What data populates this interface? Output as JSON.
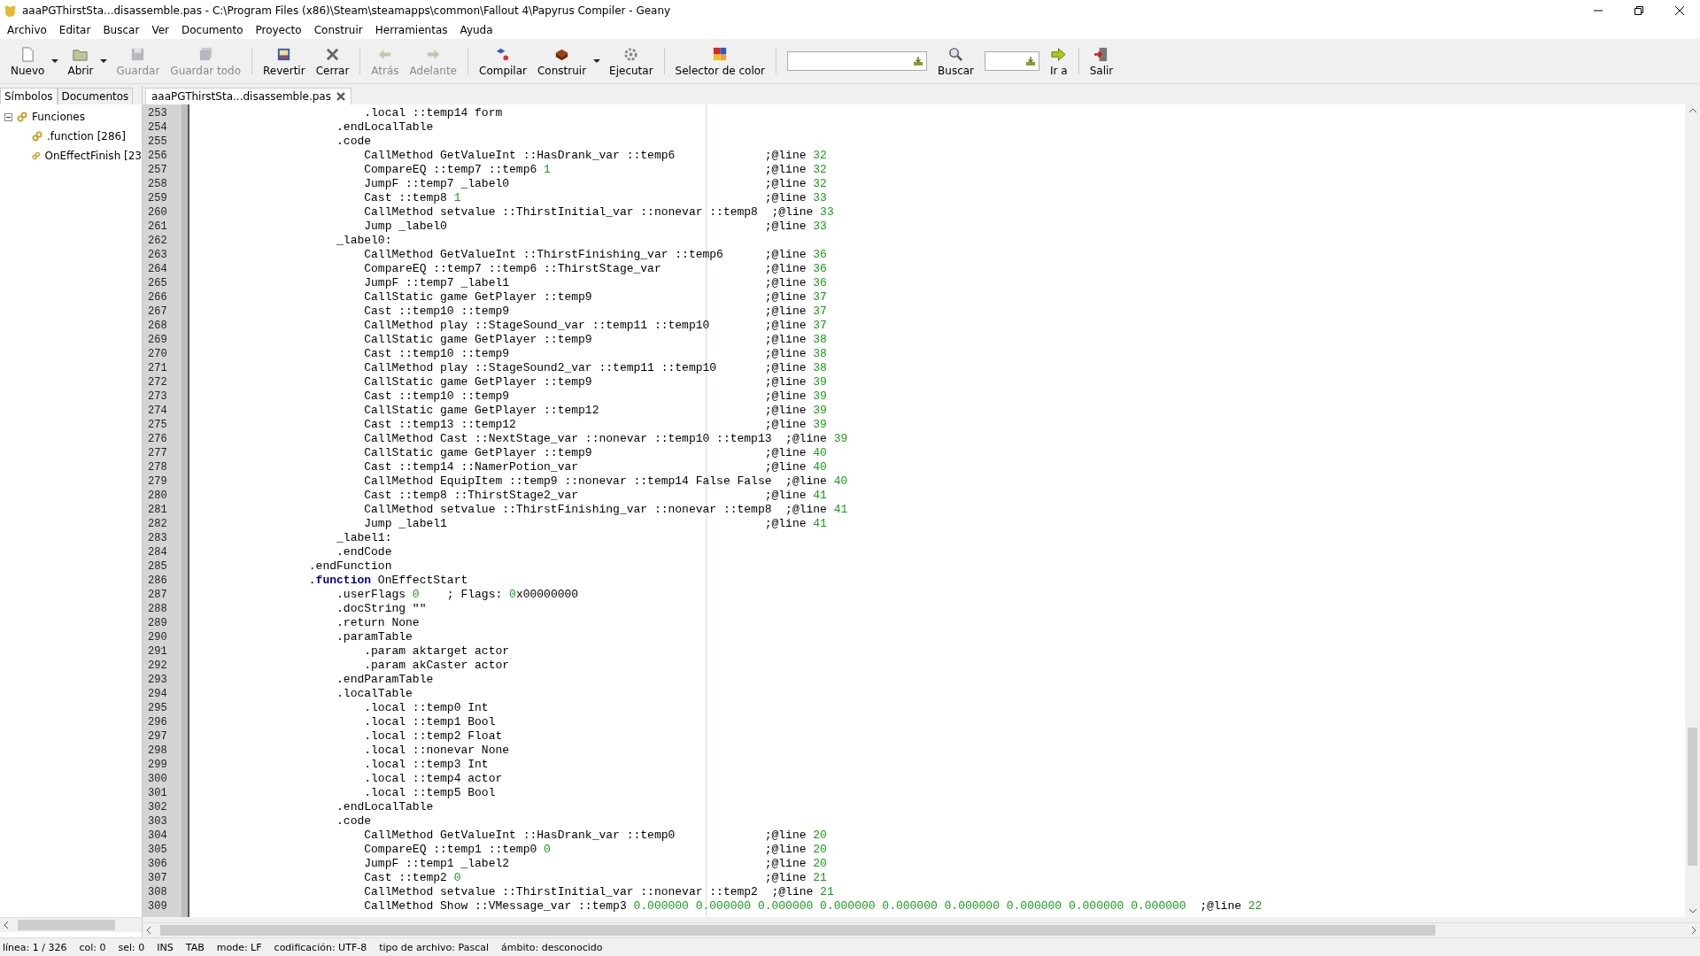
{
  "window": {
    "title": "aaaPGThirstSta...disassemble.pas - C:\\Program Files (x86)\\Steam\\steamapps\\common\\Fallout 4\\Papyrus Compiler - Geany"
  },
  "menu": [
    "Archivo",
    "Editar",
    "Buscar",
    "Ver",
    "Documento",
    "Proyecto",
    "Construir",
    "Herramientas",
    "Ayuda"
  ],
  "toolbar": [
    {
      "kind": "button",
      "label": "Nuevo",
      "disabled": false,
      "dropdown": true
    },
    {
      "kind": "button",
      "label": "Abrir",
      "disabled": false,
      "dropdown": true
    },
    {
      "kind": "button",
      "label": "Guardar",
      "disabled": true,
      "dropdown": false
    },
    {
      "kind": "button",
      "label": "Guardar todo",
      "disabled": true,
      "dropdown": false
    },
    {
      "kind": "separator"
    },
    {
      "kind": "button",
      "label": "Revertir",
      "disabled": false,
      "dropdown": false
    },
    {
      "kind": "button",
      "label": "Cerrar",
      "disabled": false,
      "dropdown": false
    },
    {
      "kind": "separator"
    },
    {
      "kind": "button",
      "label": "Atrás",
      "disabled": true,
      "dropdown": false
    },
    {
      "kind": "button",
      "label": "Adelante",
      "disabled": true,
      "dropdown": false
    },
    {
      "kind": "separator"
    },
    {
      "kind": "button",
      "label": "Compilar",
      "disabled": false,
      "dropdown": false
    },
    {
      "kind": "button",
      "label": "Construir",
      "disabled": false,
      "dropdown": true
    },
    {
      "kind": "button",
      "label": "Ejecutar",
      "disabled": false,
      "dropdown": false
    },
    {
      "kind": "separator"
    },
    {
      "kind": "button",
      "label": "Selector de color",
      "disabled": false,
      "dropdown": false
    },
    {
      "kind": "separator"
    },
    {
      "kind": "field"
    },
    {
      "kind": "button",
      "label": "Buscar",
      "disabled": false,
      "dropdown": false
    },
    {
      "kind": "field"
    },
    {
      "kind": "button",
      "label": "Ir a",
      "disabled": false,
      "dropdown": false
    },
    {
      "kind": "separator"
    },
    {
      "kind": "button",
      "label": "Salir",
      "disabled": false,
      "dropdown": false
    }
  ],
  "sidebar": {
    "tabs": [
      {
        "label": "Símbolos",
        "selected": true
      },
      {
        "label": "Documentos",
        "selected": false
      }
    ],
    "tree": [
      {
        "label": "Funciones",
        "expanded": true,
        "children": [
          {
            "label": ".function [286]"
          },
          {
            "label": "OnEffectFinish [23"
          }
        ]
      }
    ]
  },
  "editor": {
    "tab": {
      "label": "aaaPGThirstSta...disassemble.pas"
    },
    "lines": [
      {
        "n": "253",
        "code": [
          {
            "kind": "plain",
            "text": "                        .local ::temp14 form"
          }
        ]
      },
      {
        "n": "254",
        "code": [
          {
            "kind": "plain",
            "text": "                    .endLocalTable"
          }
        ]
      },
      {
        "n": "255",
        "code": [
          {
            "kind": "plain",
            "text": "                    .code"
          }
        ]
      },
      {
        "n": "256",
        "code": [
          {
            "kind": "plain",
            "text": "                        CallMethod GetValueInt ::HasDrank_var ::temp6"
          }
        ],
        "comment": {
          "label": ";@line",
          "value": "32"
        }
      },
      {
        "n": "257",
        "code": [
          {
            "kind": "plain",
            "text": "                        CompareEQ ::temp7 ::temp6 "
          },
          {
            "kind": "number",
            "text": "1"
          }
        ],
        "comment": {
          "label": ";@line",
          "value": "32"
        }
      },
      {
        "n": "258",
        "code": [
          {
            "kind": "plain",
            "text": "                        JumpF ::temp7 _label0"
          }
        ],
        "comment": {
          "label": ";@line",
          "value": "32"
        }
      },
      {
        "n": "259",
        "code": [
          {
            "kind": "plain",
            "text": "                        Cast ::temp8 "
          },
          {
            "kind": "number",
            "text": "1"
          }
        ],
        "comment": {
          "label": ";@line",
          "value": "33"
        }
      },
      {
        "n": "260",
        "code": [
          {
            "kind": "plain",
            "text": "                        CallMethod setvalue ::ThirstInitial_var ::nonevar ::temp8"
          }
        ],
        "comment": {
          "label": ";@line",
          "value": "33"
        }
      },
      {
        "n": "261",
        "code": [
          {
            "kind": "plain",
            "text": "                        Jump _label0"
          }
        ],
        "comment": {
          "label": ";@line",
          "value": "33"
        }
      },
      {
        "n": "262",
        "code": [
          {
            "kind": "plain",
            "text": "                    _label0:"
          }
        ]
      },
      {
        "n": "263",
        "code": [
          {
            "kind": "plain",
            "text": "                        CallMethod GetValueInt ::ThirstFinishing_var ::temp6"
          }
        ],
        "comment": {
          "label": ";@line",
          "value": "36"
        }
      },
      {
        "n": "264",
        "code": [
          {
            "kind": "plain",
            "text": "                        CompareEQ ::temp7 ::temp6 ::ThirstStage_var"
          }
        ],
        "comment": {
          "label": ";@line",
          "value": "36"
        }
      },
      {
        "n": "265",
        "code": [
          {
            "kind": "plain",
            "text": "                        JumpF ::temp7 _label1"
          }
        ],
        "comment": {
          "label": ";@line",
          "value": "36"
        }
      },
      {
        "n": "266",
        "code": [
          {
            "kind": "plain",
            "text": "                        CallStatic game GetPlayer ::temp9"
          }
        ],
        "comment": {
          "label": ";@line",
          "value": "37"
        }
      },
      {
        "n": "267",
        "code": [
          {
            "kind": "plain",
            "text": "                        Cast ::temp10 ::temp9"
          }
        ],
        "comment": {
          "label": ";@line",
          "value": "37"
        }
      },
      {
        "n": "268",
        "code": [
          {
            "kind": "plain",
            "text": "                        CallMethod play ::StageSound_var ::temp11 ::temp10"
          }
        ],
        "comment": {
          "label": ";@line",
          "value": "37"
        }
      },
      {
        "n": "269",
        "code": [
          {
            "kind": "plain",
            "text": "                        CallStatic game GetPlayer ::temp9"
          }
        ],
        "comment": {
          "label": ";@line",
          "value": "38"
        }
      },
      {
        "n": "270",
        "code": [
          {
            "kind": "plain",
            "text": "                        Cast ::temp10 ::temp9"
          }
        ],
        "comment": {
          "label": ";@line",
          "value": "38"
        }
      },
      {
        "n": "271",
        "code": [
          {
            "kind": "plain",
            "text": "                        CallMethod play ::StageSound2_var ::temp11 ::temp10"
          }
        ],
        "comment": {
          "label": ";@line",
          "value": "38"
        }
      },
      {
        "n": "272",
        "code": [
          {
            "kind": "plain",
            "text": "                        CallStatic game GetPlayer ::temp9"
          }
        ],
        "comment": {
          "label": ";@line",
          "value": "39"
        }
      },
      {
        "n": "273",
        "code": [
          {
            "kind": "plain",
            "text": "                        Cast ::temp10 ::temp9"
          }
        ],
        "comment": {
          "label": ";@line",
          "value": "39"
        }
      },
      {
        "n": "274",
        "code": [
          {
            "kind": "plain",
            "text": "                        CallStatic game GetPlayer ::temp12"
          }
        ],
        "comment": {
          "label": ";@line",
          "value": "39"
        }
      },
      {
        "n": "275",
        "code": [
          {
            "kind": "plain",
            "text": "                        Cast ::temp13 ::temp12"
          }
        ],
        "comment": {
          "label": ";@line",
          "value": "39"
        }
      },
      {
        "n": "276",
        "code": [
          {
            "kind": "plain",
            "text": "                        CallMethod Cast ::NextStage_var ::nonevar ::temp10 ::temp13"
          }
        ],
        "comment": {
          "label": ";@line",
          "value": "39"
        }
      },
      {
        "n": "277",
        "code": [
          {
            "kind": "plain",
            "text": "                        CallStatic game GetPlayer ::temp9"
          }
        ],
        "comment": {
          "label": ";@line",
          "value": "40"
        }
      },
      {
        "n": "278",
        "code": [
          {
            "kind": "plain",
            "text": "                        Cast ::temp14 ::NamerPotion_var"
          }
        ],
        "comment": {
          "label": ";@line",
          "value": "40"
        }
      },
      {
        "n": "279",
        "code": [
          {
            "kind": "plain",
            "text": "                        CallMethod EquipItem ::temp9 ::nonevar ::temp14 False False"
          }
        ],
        "comment": {
          "label": ";@line",
          "value": "40"
        }
      },
      {
        "n": "280",
        "code": [
          {
            "kind": "plain",
            "text": "                        Cast ::temp8 ::ThirstStage2_var"
          }
        ],
        "comment": {
          "label": ";@line",
          "value": "41"
        }
      },
      {
        "n": "281",
        "code": [
          {
            "kind": "plain",
            "text": "                        CallMethod setvalue ::ThirstFinishing_var ::nonevar ::temp8"
          }
        ],
        "comment": {
          "label": ";@line",
          "value": "41"
        }
      },
      {
        "n": "282",
        "code": [
          {
            "kind": "plain",
            "text": "                        Jump _label1"
          }
        ],
        "comment": {
          "label": ";@line",
          "value": "41"
        }
      },
      {
        "n": "283",
        "code": [
          {
            "kind": "plain",
            "text": "                    _label1:"
          }
        ]
      },
      {
        "n": "284",
        "code": [
          {
            "kind": "plain",
            "text": "                    .endCode"
          }
        ]
      },
      {
        "n": "285",
        "code": [
          {
            "kind": "plain",
            "text": "                .endFunction"
          }
        ]
      },
      {
        "n": "286",
        "code": [
          {
            "kind": "keyword",
            "text": "                .function"
          },
          {
            "kind": "plain",
            "text": " OnEffectStart"
          }
        ]
      },
      {
        "n": "287",
        "code": [
          {
            "kind": "plain",
            "text": "                    .userFlags "
          },
          {
            "kind": "number",
            "text": "0"
          },
          {
            "kind": "plain",
            "text": "    ; Flags: "
          },
          {
            "kind": "number",
            "text": "0"
          },
          {
            "kind": "plain",
            "text": "x00000000"
          }
        ]
      },
      {
        "n": "288",
        "code": [
          {
            "kind": "plain",
            "text": "                    .docString \"\""
          }
        ]
      },
      {
        "n": "289",
        "code": [
          {
            "kind": "plain",
            "text": "                    .return None"
          }
        ]
      },
      {
        "n": "290",
        "code": [
          {
            "kind": "plain",
            "text": "                    .paramTable"
          }
        ]
      },
      {
        "n": "291",
        "code": [
          {
            "kind": "plain",
            "text": "                        .param aktarget actor"
          }
        ]
      },
      {
        "n": "292",
        "code": [
          {
            "kind": "plain",
            "text": "                        .param akCaster actor"
          }
        ]
      },
      {
        "n": "293",
        "code": [
          {
            "kind": "plain",
            "text": "                    .endParamTable"
          }
        ]
      },
      {
        "n": "294",
        "code": [
          {
            "kind": "plain",
            "text": "                    .localTable"
          }
        ]
      },
      {
        "n": "295",
        "code": [
          {
            "kind": "plain",
            "text": "                        .local ::temp0 Int"
          }
        ]
      },
      {
        "n": "296",
        "code": [
          {
            "kind": "plain",
            "text": "                        .local ::temp1 Bool"
          }
        ]
      },
      {
        "n": "297",
        "code": [
          {
            "kind": "plain",
            "text": "                        .local ::temp2 Float"
          }
        ]
      },
      {
        "n": "298",
        "code": [
          {
            "kind": "plain",
            "text": "                        .local ::nonevar None"
          }
        ]
      },
      {
        "n": "299",
        "code": [
          {
            "kind": "plain",
            "text": "                        .local ::temp3 Int"
          }
        ]
      },
      {
        "n": "300",
        "code": [
          {
            "kind": "plain",
            "text": "                        .local ::temp4 actor"
          }
        ]
      },
      {
        "n": "301",
        "code": [
          {
            "kind": "plain",
            "text": "                        .local ::temp5 Bool"
          }
        ]
      },
      {
        "n": "302",
        "code": [
          {
            "kind": "plain",
            "text": "                    .endLocalTable"
          }
        ]
      },
      {
        "n": "303",
        "code": [
          {
            "kind": "plain",
            "text": "                    .code"
          }
        ]
      },
      {
        "n": "304",
        "code": [
          {
            "kind": "plain",
            "text": "                        CallMethod GetValueInt ::HasDrank_var ::temp0"
          }
        ],
        "comment": {
          "label": ";@line",
          "value": "20"
        }
      },
      {
        "n": "305",
        "code": [
          {
            "kind": "plain",
            "text": "                        CompareEQ ::temp1 ::temp0 "
          },
          {
            "kind": "number",
            "text": "0"
          }
        ],
        "comment": {
          "label": ";@line",
          "value": "20"
        }
      },
      {
        "n": "306",
        "code": [
          {
            "kind": "plain",
            "text": "                        JumpF ::temp1 _label2"
          }
        ],
        "comment": {
          "label": ";@line",
          "value": "20"
        }
      },
      {
        "n": "307",
        "code": [
          {
            "kind": "plain",
            "text": "                        Cast ::temp2 "
          },
          {
            "kind": "number",
            "text": "0"
          }
        ],
        "comment": {
          "label": ";@line",
          "value": "21"
        }
      },
      {
        "n": "308",
        "code": [
          {
            "kind": "plain",
            "text": "                        CallMethod setvalue ::ThirstInitial_var ::nonevar ::temp2"
          }
        ],
        "comment": {
          "label": ";@line",
          "value": "21"
        }
      },
      {
        "n": "309",
        "code": [
          {
            "kind": "plain",
            "text": "                        CallMethod Show ::VMessage_var ::temp3 "
          },
          {
            "kind": "number",
            "text": "0.000000 0.000000 0.000000 0.000000 0.000000 0.000000 0.000000 0.000000 0.000000"
          }
        ],
        "comment": {
          "label": ";@line",
          "value": "22"
        }
      }
    ]
  },
  "status_bar": [
    "línea: 1 / 326",
    "col: 0",
    "sel: 0",
    "INS",
    "TAB",
    "mode: LF",
    "codificación: UTF-8",
    "tipo de archivo: Pascal",
    "ámbito: desconocido"
  ]
}
